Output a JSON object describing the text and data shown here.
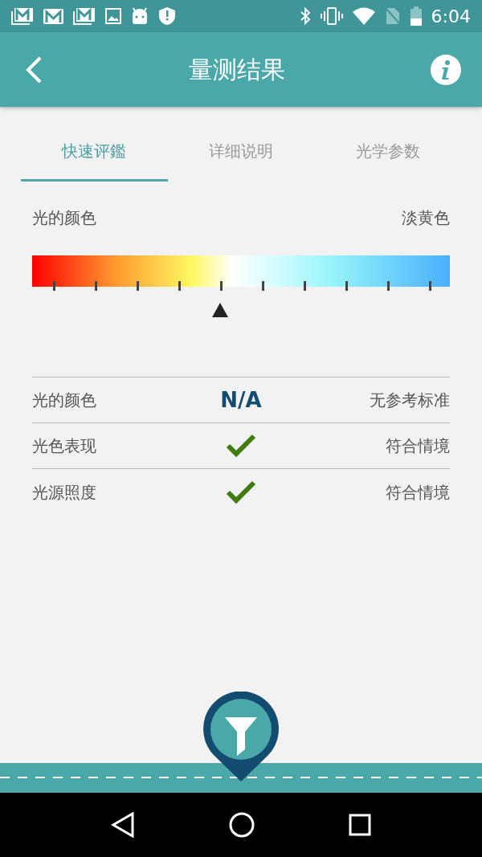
{
  "status_bar": {
    "time": "6:04"
  },
  "app_bar": {
    "title": "量测结果"
  },
  "tabs": [
    {
      "label": "快速评鑑",
      "selected": true
    },
    {
      "label": "详细说明",
      "selected": false
    },
    {
      "label": "光学参数",
      "selected": false
    }
  ],
  "light_color": {
    "label": "光的颜色",
    "value": "淡黄色"
  },
  "results": [
    {
      "kind": "text",
      "label": "光的颜色",
      "result": "N/A",
      "note": "无参考标准"
    },
    {
      "kind": "check",
      "label": "光色表现",
      "note": "符合情境"
    },
    {
      "kind": "check",
      "label": "光源照度",
      "note": "符合情境"
    }
  ]
}
